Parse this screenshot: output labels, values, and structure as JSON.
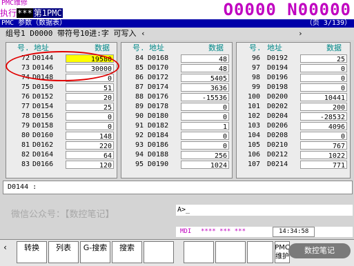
{
  "top": {
    "label": "PMC维修",
    "mode1": "执行",
    "mode2": "***",
    "mode3": "第1PMC",
    "program": "O0000 N00000"
  },
  "title": {
    "left": "PMC 参数（数据表）",
    "right": "（页   3/139）"
  },
  "header": {
    "left": "组号1  D0000 带符号10进:字 可写入 ‹",
    "right": "›"
  },
  "columns": {
    "no": "号.",
    "addr": "地址",
    "data": "数据"
  },
  "col1": [
    {
      "no": "72",
      "addr": "D0144",
      "val": "19580",
      "sel": true
    },
    {
      "no": "73",
      "addr": "D0146",
      "val": "30000"
    },
    {
      "no": "74",
      "addr": "D0148",
      "val": "0"
    },
    {
      "no": "75",
      "addr": "D0150",
      "val": "51"
    },
    {
      "no": "76",
      "addr": "D0152",
      "val": "20"
    },
    {
      "no": "77",
      "addr": "D0154",
      "val": "25"
    },
    {
      "no": "78",
      "addr": "D0156",
      "val": "0"
    },
    {
      "no": "79",
      "addr": "D0158",
      "val": "0"
    },
    {
      "no": "80",
      "addr": "D0160",
      "val": "148"
    },
    {
      "no": "81",
      "addr": "D0162",
      "val": "220"
    },
    {
      "no": "82",
      "addr": "D0164",
      "val": "64"
    },
    {
      "no": "83",
      "addr": "D0166",
      "val": "120"
    }
  ],
  "col2": [
    {
      "no": "84",
      "addr": "D0168",
      "val": "48"
    },
    {
      "no": "85",
      "addr": "D0170",
      "val": "48"
    },
    {
      "no": "86",
      "addr": "D0172",
      "val": "5405"
    },
    {
      "no": "87",
      "addr": "D0174",
      "val": "3636"
    },
    {
      "no": "88",
      "addr": "D0176",
      "val": "-15536"
    },
    {
      "no": "89",
      "addr": "D0178",
      "val": "0"
    },
    {
      "no": "90",
      "addr": "D0180",
      "val": "0"
    },
    {
      "no": "91",
      "addr": "D0182",
      "val": "1"
    },
    {
      "no": "92",
      "addr": "D0184",
      "val": "0"
    },
    {
      "no": "93",
      "addr": "D0186",
      "val": "0"
    },
    {
      "no": "94",
      "addr": "D0188",
      "val": "256"
    },
    {
      "no": "95",
      "addr": "D0190",
      "val": "1024"
    }
  ],
  "col3": [
    {
      "no": "96",
      "addr": "D0192",
      "val": "25"
    },
    {
      "no": "97",
      "addr": "D0194",
      "val": "0"
    },
    {
      "no": "98",
      "addr": "D0196",
      "val": "0"
    },
    {
      "no": "99",
      "addr": "D0198",
      "val": "0"
    },
    {
      "no": "100",
      "addr": "D0200",
      "val": "10441"
    },
    {
      "no": "101",
      "addr": "D0202",
      "val": "200"
    },
    {
      "no": "102",
      "addr": "D0204",
      "val": "-28532"
    },
    {
      "no": "103",
      "addr": "D0206",
      "val": "4096"
    },
    {
      "no": "104",
      "addr": "D0208",
      "val": "0"
    },
    {
      "no": "105",
      "addr": "D0210",
      "val": "767"
    },
    {
      "no": "106",
      "addr": "D0212",
      "val": "1022"
    },
    {
      "no": "107",
      "addr": "D0214",
      "val": "771"
    }
  ],
  "cmdline": "D0144 :",
  "watermark": "微信公众号：【数控笔记】",
  "input": "A>_",
  "status": {
    "mode": "MDI",
    "stars": "**** *** ***",
    "time": "14:34:58"
  },
  "softkeys": {
    "back": "‹",
    "k1": "转换",
    "k2": "列表",
    "k3": "G-搜索",
    "k4": "搜索",
    "k9": "PMC维护"
  },
  "badge": "数控笔记",
  "colors": {
    "accent": "#c000c0",
    "titlebar": "#0000a8",
    "selected": "#ffff00",
    "highlight_circle": "#e00000"
  }
}
